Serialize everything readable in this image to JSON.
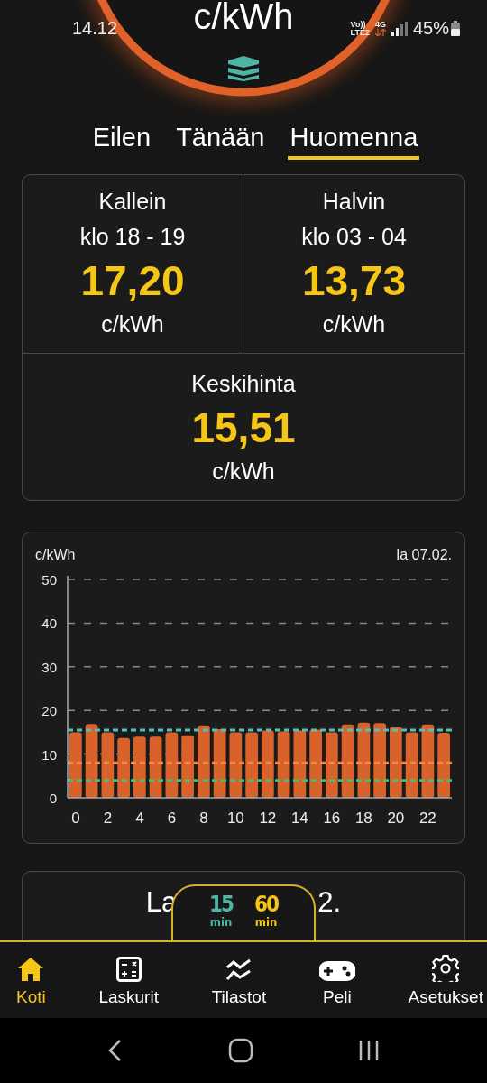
{
  "status_bar": {
    "time": "14.12",
    "network": "Vo))",
    "network_2": "LTE2",
    "data_type": "4G",
    "battery": "45%"
  },
  "gauge": {
    "unit": "c/kWh"
  },
  "day_tabs": [
    {
      "label": "Eilen",
      "selected": false
    },
    {
      "label": "Tänään",
      "selected": false
    },
    {
      "label": "Huomenna",
      "selected": true
    }
  ],
  "summary": {
    "highest": {
      "label": "Kallein",
      "time": "klo 18 - 19",
      "price": "17,20",
      "unit": "c/kWh"
    },
    "lowest": {
      "label": "Halvin",
      "time": "klo 03 - 04",
      "price": "13,73",
      "unit": "c/kWh"
    },
    "average": {
      "label": "Keskihinta",
      "price": "15,51",
      "unit": "c/kWh"
    }
  },
  "chart": {
    "date": "la 07.02.",
    "chart_data": {
      "type": "bar",
      "ylabel": "c/kWh",
      "xlim": [
        -0.5,
        23.5
      ],
      "x": [
        0,
        1,
        2,
        3,
        4,
        5,
        6,
        7,
        8,
        9,
        10,
        11,
        12,
        13,
        14,
        15,
        16,
        17,
        18,
        19,
        20,
        21,
        22,
        23
      ],
      "series": [
        {
          "color": "#d9612a",
          "values": [
            15.0,
            16.9,
            15.0,
            13.7,
            14.0,
            14.0,
            15.0,
            14.3,
            16.6,
            15.7,
            15.0,
            15.0,
            15.4,
            15.2,
            15.4,
            15.6,
            15.0,
            16.8,
            17.2,
            17.1,
            16.2,
            15.0,
            16.8,
            14.9
          ]
        }
      ],
      "ylim": [
        0,
        50
      ],
      "yticks": [
        0,
        10,
        20,
        30,
        40,
        50
      ],
      "xticks": [
        0,
        2,
        4,
        6,
        8,
        10,
        12,
        14,
        16,
        18,
        20,
        22
      ],
      "grid": true,
      "ref_lines": [
        {
          "axis": "y",
          "value": 15.51,
          "color": "#4fc3b8"
        },
        {
          "axis": "y",
          "value": 8,
          "color": "#f0884a"
        },
        {
          "axis": "y",
          "value": 4,
          "color": "#3fbf7f"
        }
      ]
    }
  },
  "day_card": {
    "title_start": "La",
    "title_end": "2."
  },
  "interval_toggle": [
    {
      "value": "15",
      "unit": "min",
      "selected": false
    },
    {
      "value": "60",
      "unit": "min",
      "selected": true
    }
  ],
  "bottom_nav": [
    {
      "label": "Koti",
      "selected": true
    },
    {
      "label": "Laskurit",
      "selected": false
    },
    {
      "label": "Tilastot",
      "selected": false
    },
    {
      "label": "Peli",
      "selected": false
    },
    {
      "label": "Asetukset",
      "selected": false
    }
  ]
}
